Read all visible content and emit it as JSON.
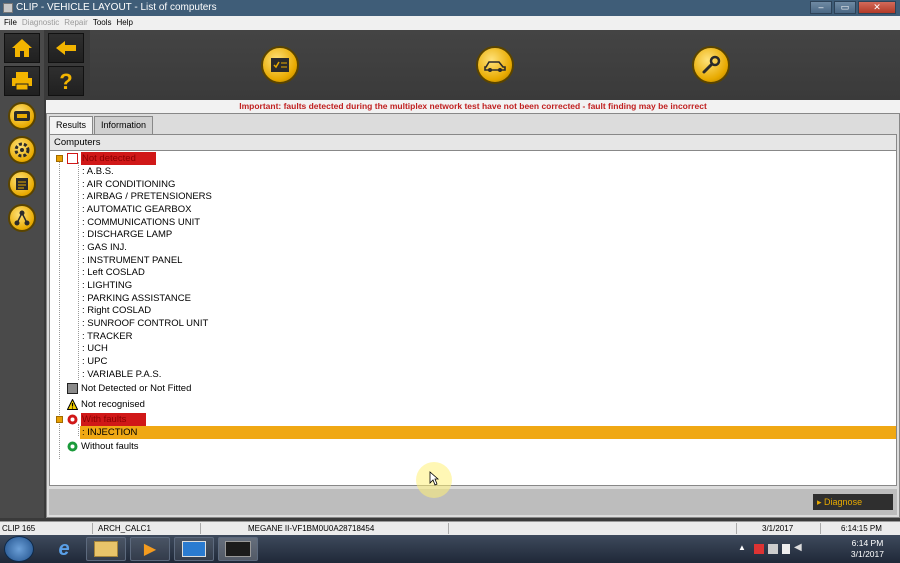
{
  "window": {
    "title": "CLIP - VEHICLE LAYOUT - List of computers",
    "controls": [
      "–",
      "▭",
      "✕"
    ]
  },
  "menu": {
    "items": [
      {
        "label": "File",
        "enabled": true
      },
      {
        "label": "Diagnostic",
        "enabled": false
      },
      {
        "label": "Repair",
        "enabled": false
      },
      {
        "label": "Tools",
        "enabled": true
      },
      {
        "label": "Help",
        "enabled": true
      }
    ]
  },
  "banner": {
    "text": "Important: faults detected during the multiplex network test have not been corrected - fault finding may be incorrect",
    "color": "#c02020"
  },
  "tabs": [
    {
      "label": "Results",
      "active": true
    },
    {
      "label": "Information",
      "active": false
    }
  ],
  "tree": {
    "column_header": "Computers",
    "categories": [
      {
        "label": "Not detected",
        "icon": "not-detected-icon",
        "highlight": true,
        "children": [
          ": A.B.S.",
          ": AIR CONDITIONING",
          ": AIRBAG / PRETENSIONERS",
          ": AUTOMATIC GEARBOX",
          ": COMMUNICATIONS UNIT",
          ": DISCHARGE LAMP",
          ": GAS INJ.",
          ": INSTRUMENT PANEL",
          ": Left COSLAD",
          ": LIGHTING",
          ": PARKING ASSISTANCE",
          ": Right COSLAD",
          ": SUNROOF CONTROL UNIT",
          ": TRACKER",
          ": UCH",
          ": UPC",
          ": VARIABLE P.A.S."
        ]
      },
      {
        "label": "Not Detected or Not Fitted",
        "icon": "not-fitted-icon",
        "highlight": false,
        "children": []
      },
      {
        "label": "Not recognised",
        "icon": "warning-icon",
        "highlight": false,
        "children": []
      },
      {
        "label": "With faults",
        "icon": "fault-icon",
        "highlight": true,
        "children": [
          ": INJECTION"
        ],
        "selected_child": 0
      },
      {
        "label": "Without faults",
        "icon": "ok-icon",
        "highlight": false,
        "children": []
      }
    ]
  },
  "actions": {
    "diagnose_label": "Diagnose"
  },
  "statusbar": {
    "version": "CLIP 165",
    "calc": "ARCH_CALC1",
    "vehicle": "MEGANE II-VF1BM0U0A28718454",
    "date": "3/1/2017",
    "time": "6:14:15 PM"
  },
  "taskbar": {
    "time": "6:14 PM",
    "date": "3/1/2017"
  },
  "colors": {
    "accent": "#e8aa00",
    "selection": "#f0a814",
    "highlight_red": "#d01818",
    "banner_red": "#c02020"
  }
}
